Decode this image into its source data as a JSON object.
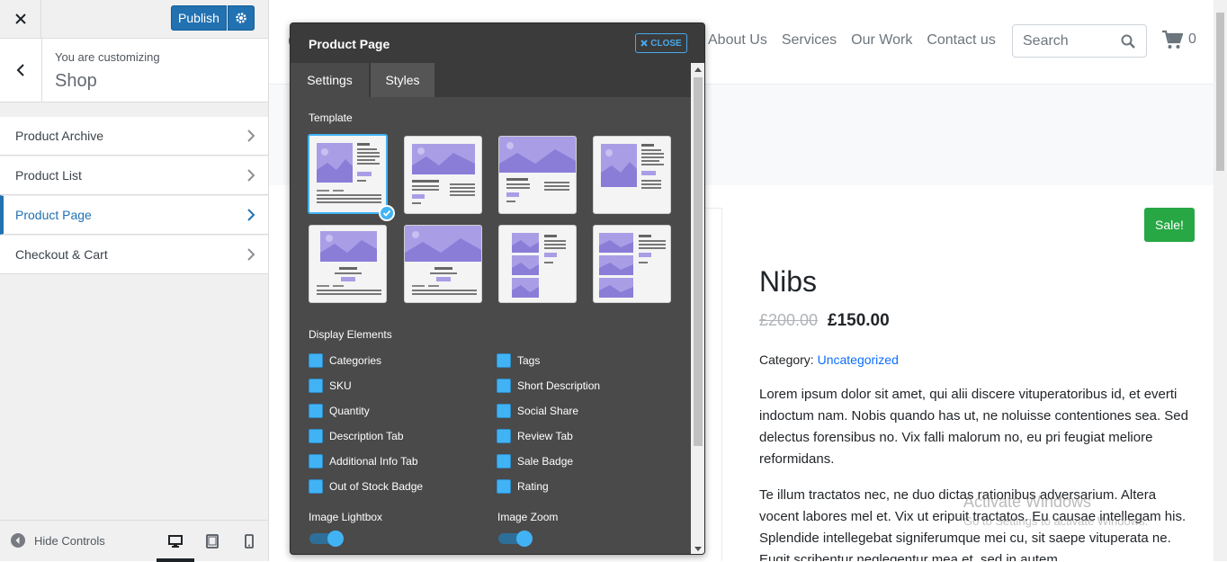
{
  "sidebar": {
    "close_icon": "close-icon",
    "publish_label": "Publish",
    "customizing_label": "You are customizing",
    "section_title": "Shop",
    "items": [
      {
        "label": "Product Archive"
      },
      {
        "label": "Product List"
      },
      {
        "label": "Product Page",
        "active": true
      },
      {
        "label": "Checkout & Cart"
      }
    ],
    "hide_controls_label": "Hide Controls",
    "devices": [
      "desktop",
      "tablet",
      "mobile"
    ],
    "active_device": "desktop"
  },
  "site": {
    "nav": [
      "About Us",
      "Services",
      "Our Work",
      "Contact us"
    ],
    "search_placeholder": "Search",
    "cart_count": "0",
    "sale_badge": "Sale!",
    "product_name": "Nibs",
    "old_price": "£200.00",
    "new_price": "£150.00",
    "category_label": "Category:",
    "category_value": "Uncategorized",
    "description_1": "Lorem ipsum dolor sit amet, qui alii discere vituperatoribus id, et everti indoctum nam. Nobis quando has ut, ne noluisse contentiones sea. Sed delectus forensibus no. Vix falli malorum no, eu pri feugiat meliore reformidans.",
    "description_2": "Te illum tractatos nec, ne duo dictas rationibus adversarium. Altera vocent labores mel et. Vix ut eripuit tractatos. Eu causae intellegam his. Splendide intellegebat signiferumque mei cu, sit saepe vituperata ne. Eugit scribentur neglegentur mea et, sed in autem",
    "watermark_title": "Activate Windows",
    "watermark_sub": "Go to Settings to activate Windows."
  },
  "modal": {
    "title": "Product Page",
    "close_label": "CLOSE",
    "tabs": [
      "Settings",
      "Styles"
    ],
    "active_tab": "Settings",
    "template_label": "Template",
    "selected_template": 0,
    "display_label": "Display Elements",
    "elements_left": [
      "Categories",
      "SKU",
      "Quantity",
      "Description Tab",
      "Additional Info Tab",
      "Out of Stock Badge"
    ],
    "elements_right": [
      "Tags",
      "Short Description",
      "Social Share",
      "Review Tab",
      "Sale Badge",
      "Rating"
    ],
    "lightbox_label": "Image Lightbox",
    "zoom_label": "Image Zoom",
    "lightbox_on": true,
    "zoom_on": true
  },
  "colors": {
    "accent": "#41b3f5",
    "publish": "#2271b1",
    "sale": "#28a745",
    "link": "#0d6efd",
    "template_image": "#a99ee6"
  }
}
